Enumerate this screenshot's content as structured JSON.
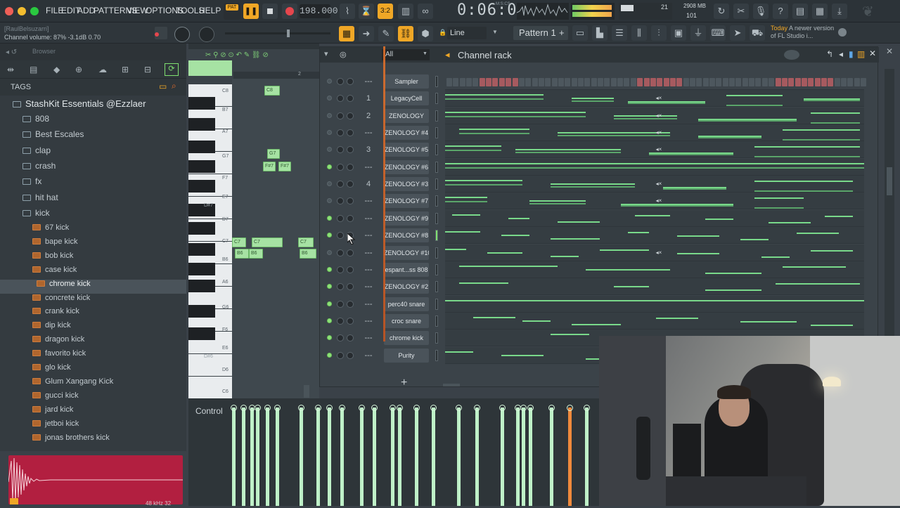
{
  "menubar": {
    "items": [
      "FILE",
      "EDIT",
      "ADD",
      "PATTERNS",
      "VIEW",
      "OPTIONS",
      "TOOLS",
      "HELP"
    ],
    "pat_label": "PAT",
    "tempo": "198.000",
    "time": "0:06:00",
    "time_unit": "M:S:CS",
    "cpu": "21",
    "memory": "2908 MB",
    "voices": "101"
  },
  "toolbar": {
    "hint": "[RaulBelsuzarri]",
    "channel_volume": "Channel volume: 87%  -3.1dB  0.70",
    "snap": "Line",
    "pattern": "Pattern 1",
    "news_label": "Today",
    "news_text": "A newer version of FL Studio i..."
  },
  "browser": {
    "title": "Browser",
    "tags": "TAGS",
    "root": "StashKit Essentials @Ezzlaer",
    "folders": [
      "808",
      "Best Escales",
      "clap",
      "crash",
      "fx",
      "hit hat",
      "kick"
    ],
    "kicks": [
      "67 kick",
      "bape kick",
      "bob kick",
      "case kick",
      "chrome kick",
      "concrete kick",
      "crank kick",
      "dip kick",
      "dragon kick",
      "favorito kick",
      "glo kick",
      "Glum Xangang Kick",
      "gucci kick",
      "jard kick",
      "jetboi kick",
      "jonas brothers kick"
    ],
    "selected": "chrome kick",
    "sample_info": "48 kHz 32"
  },
  "pianoroll": {
    "keys": [
      "C8",
      "B7",
      "A7",
      "G7",
      "F7",
      "E7",
      "D#7",
      "D7",
      "C7",
      "B6",
      "A6",
      "G6",
      "F6",
      "E6",
      "D#6",
      "D6",
      "C6"
    ],
    "notes": [
      "C8",
      "G7",
      "F#7",
      "F#7",
      "C7",
      "C7",
      "C7",
      "B6",
      "B6",
      "B6"
    ],
    "ruler": [
      "2"
    ]
  },
  "control": {
    "label": "Control"
  },
  "rack": {
    "title": "Channel rack",
    "filter": "All",
    "channels": [
      {
        "route": "---",
        "name": "Sampler",
        "on": false
      },
      {
        "route": "1",
        "name": "LegacyCell",
        "on": false
      },
      {
        "route": "2",
        "name": "ZENOLOGY",
        "on": false
      },
      {
        "route": "---",
        "name": "ZENOLOGY #4",
        "on": false
      },
      {
        "route": "3",
        "name": "ZENOLOGY #5",
        "on": false
      },
      {
        "route": "---",
        "name": "ZENOLOGY #6",
        "on": true
      },
      {
        "route": "4",
        "name": "ZENOLOGY #3",
        "on": false
      },
      {
        "route": "---",
        "name": "ZENOLOGY #7",
        "on": false
      },
      {
        "route": "---",
        "name": "ZENOLOGY #9",
        "on": true
      },
      {
        "route": "---",
        "name": "ZENOLOGY #8",
        "on": true
      },
      {
        "route": "---",
        "name": "ZENOLOGY #10",
        "on": false
      },
      {
        "route": "---",
        "name": "espant...ss 808",
        "on": true
      },
      {
        "route": "---",
        "name": "ZENOLOGY #2",
        "on": true
      },
      {
        "route": "---",
        "name": "perc40 snare",
        "on": true
      },
      {
        "route": "---",
        "name": "croc snare",
        "on": true
      },
      {
        "route": "---",
        "name": "chrome kick",
        "on": true
      },
      {
        "route": "---",
        "name": "Purity",
        "on": true
      }
    ],
    "add": "+"
  }
}
